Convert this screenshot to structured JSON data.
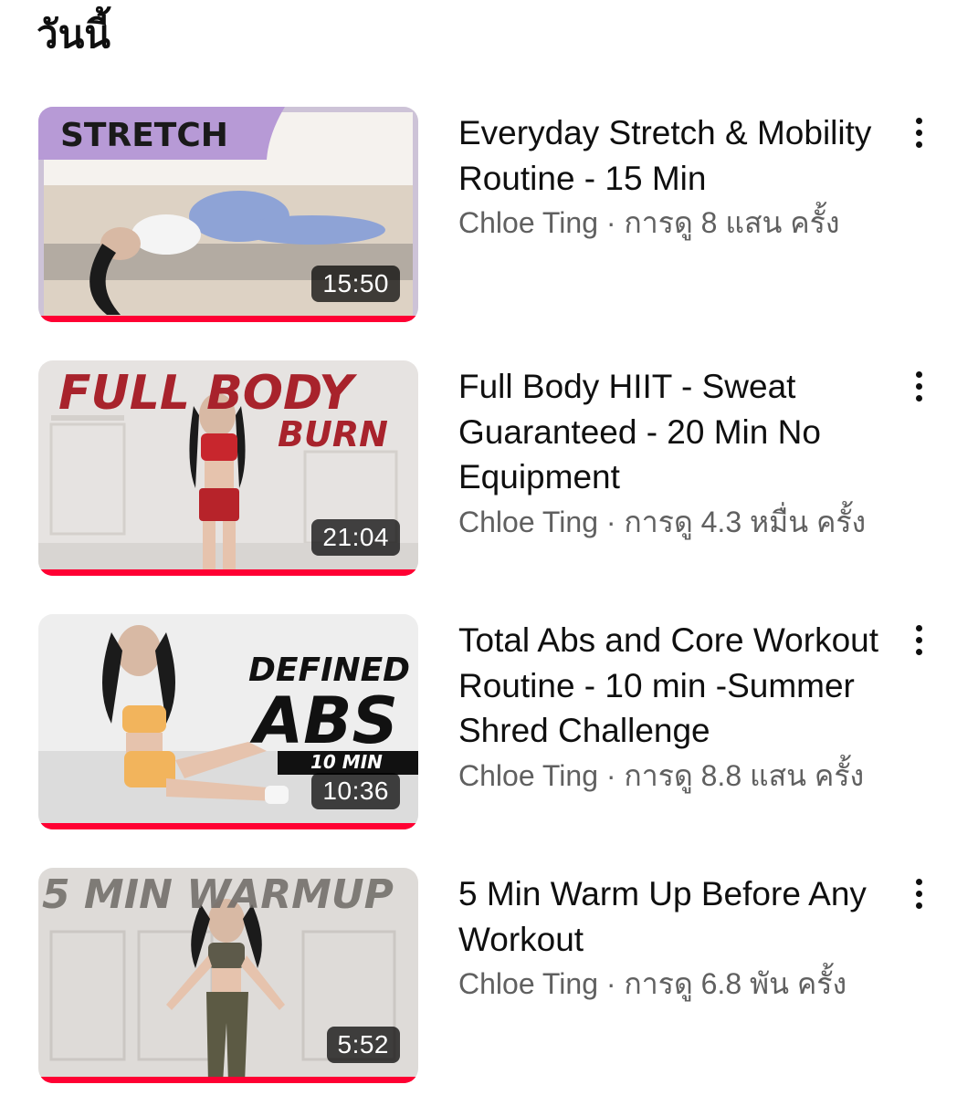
{
  "section": {
    "title": "วันนี้"
  },
  "videos": [
    {
      "title": "Everyday Stretch & Mobility Routine - 15 Min",
      "channel": "Chloe Ting",
      "separator": " · ",
      "views": "การดู 8 แสน ครั้ง",
      "duration": "15:50",
      "thumb_text": [
        "STRETCH"
      ],
      "watch_progress": 1.0
    },
    {
      "title": "Full Body HIIT - Sweat Guaranteed - 20 Min No Equipment",
      "channel": "Chloe Ting",
      "separator": " · ",
      "views": "การดู 4.3 หมื่น ครั้ง",
      "duration": "21:04",
      "thumb_text": [
        "FULL BODY",
        "BURN"
      ],
      "watch_progress": 1.0
    },
    {
      "title": "Total Abs and Core Workout Routine - 10 min -Summer Shred Challenge",
      "channel": "Chloe Ting",
      "separator": " · ",
      "views": "การดู 8.8 แสน ครั้ง",
      "duration": "10:36",
      "thumb_text": [
        "DEFINED",
        "ABS",
        "10 MIN"
      ],
      "watch_progress": 1.0
    },
    {
      "title": "5 Min Warm Up Before Any Workout",
      "channel": "Chloe Ting",
      "separator": " · ",
      "views": "การดู 6.8 พัน ครั้ง",
      "duration": "5:52",
      "thumb_text": [
        "5 MIN WARMUP"
      ],
      "watch_progress": 1.0
    }
  ],
  "colors": {
    "progress": "#ff0033",
    "title_text": "#0f0f0f",
    "subtitle_text": "#606060",
    "stretch_banner": "#b79ad6"
  },
  "icons": {
    "more": "more-vertical-icon"
  }
}
